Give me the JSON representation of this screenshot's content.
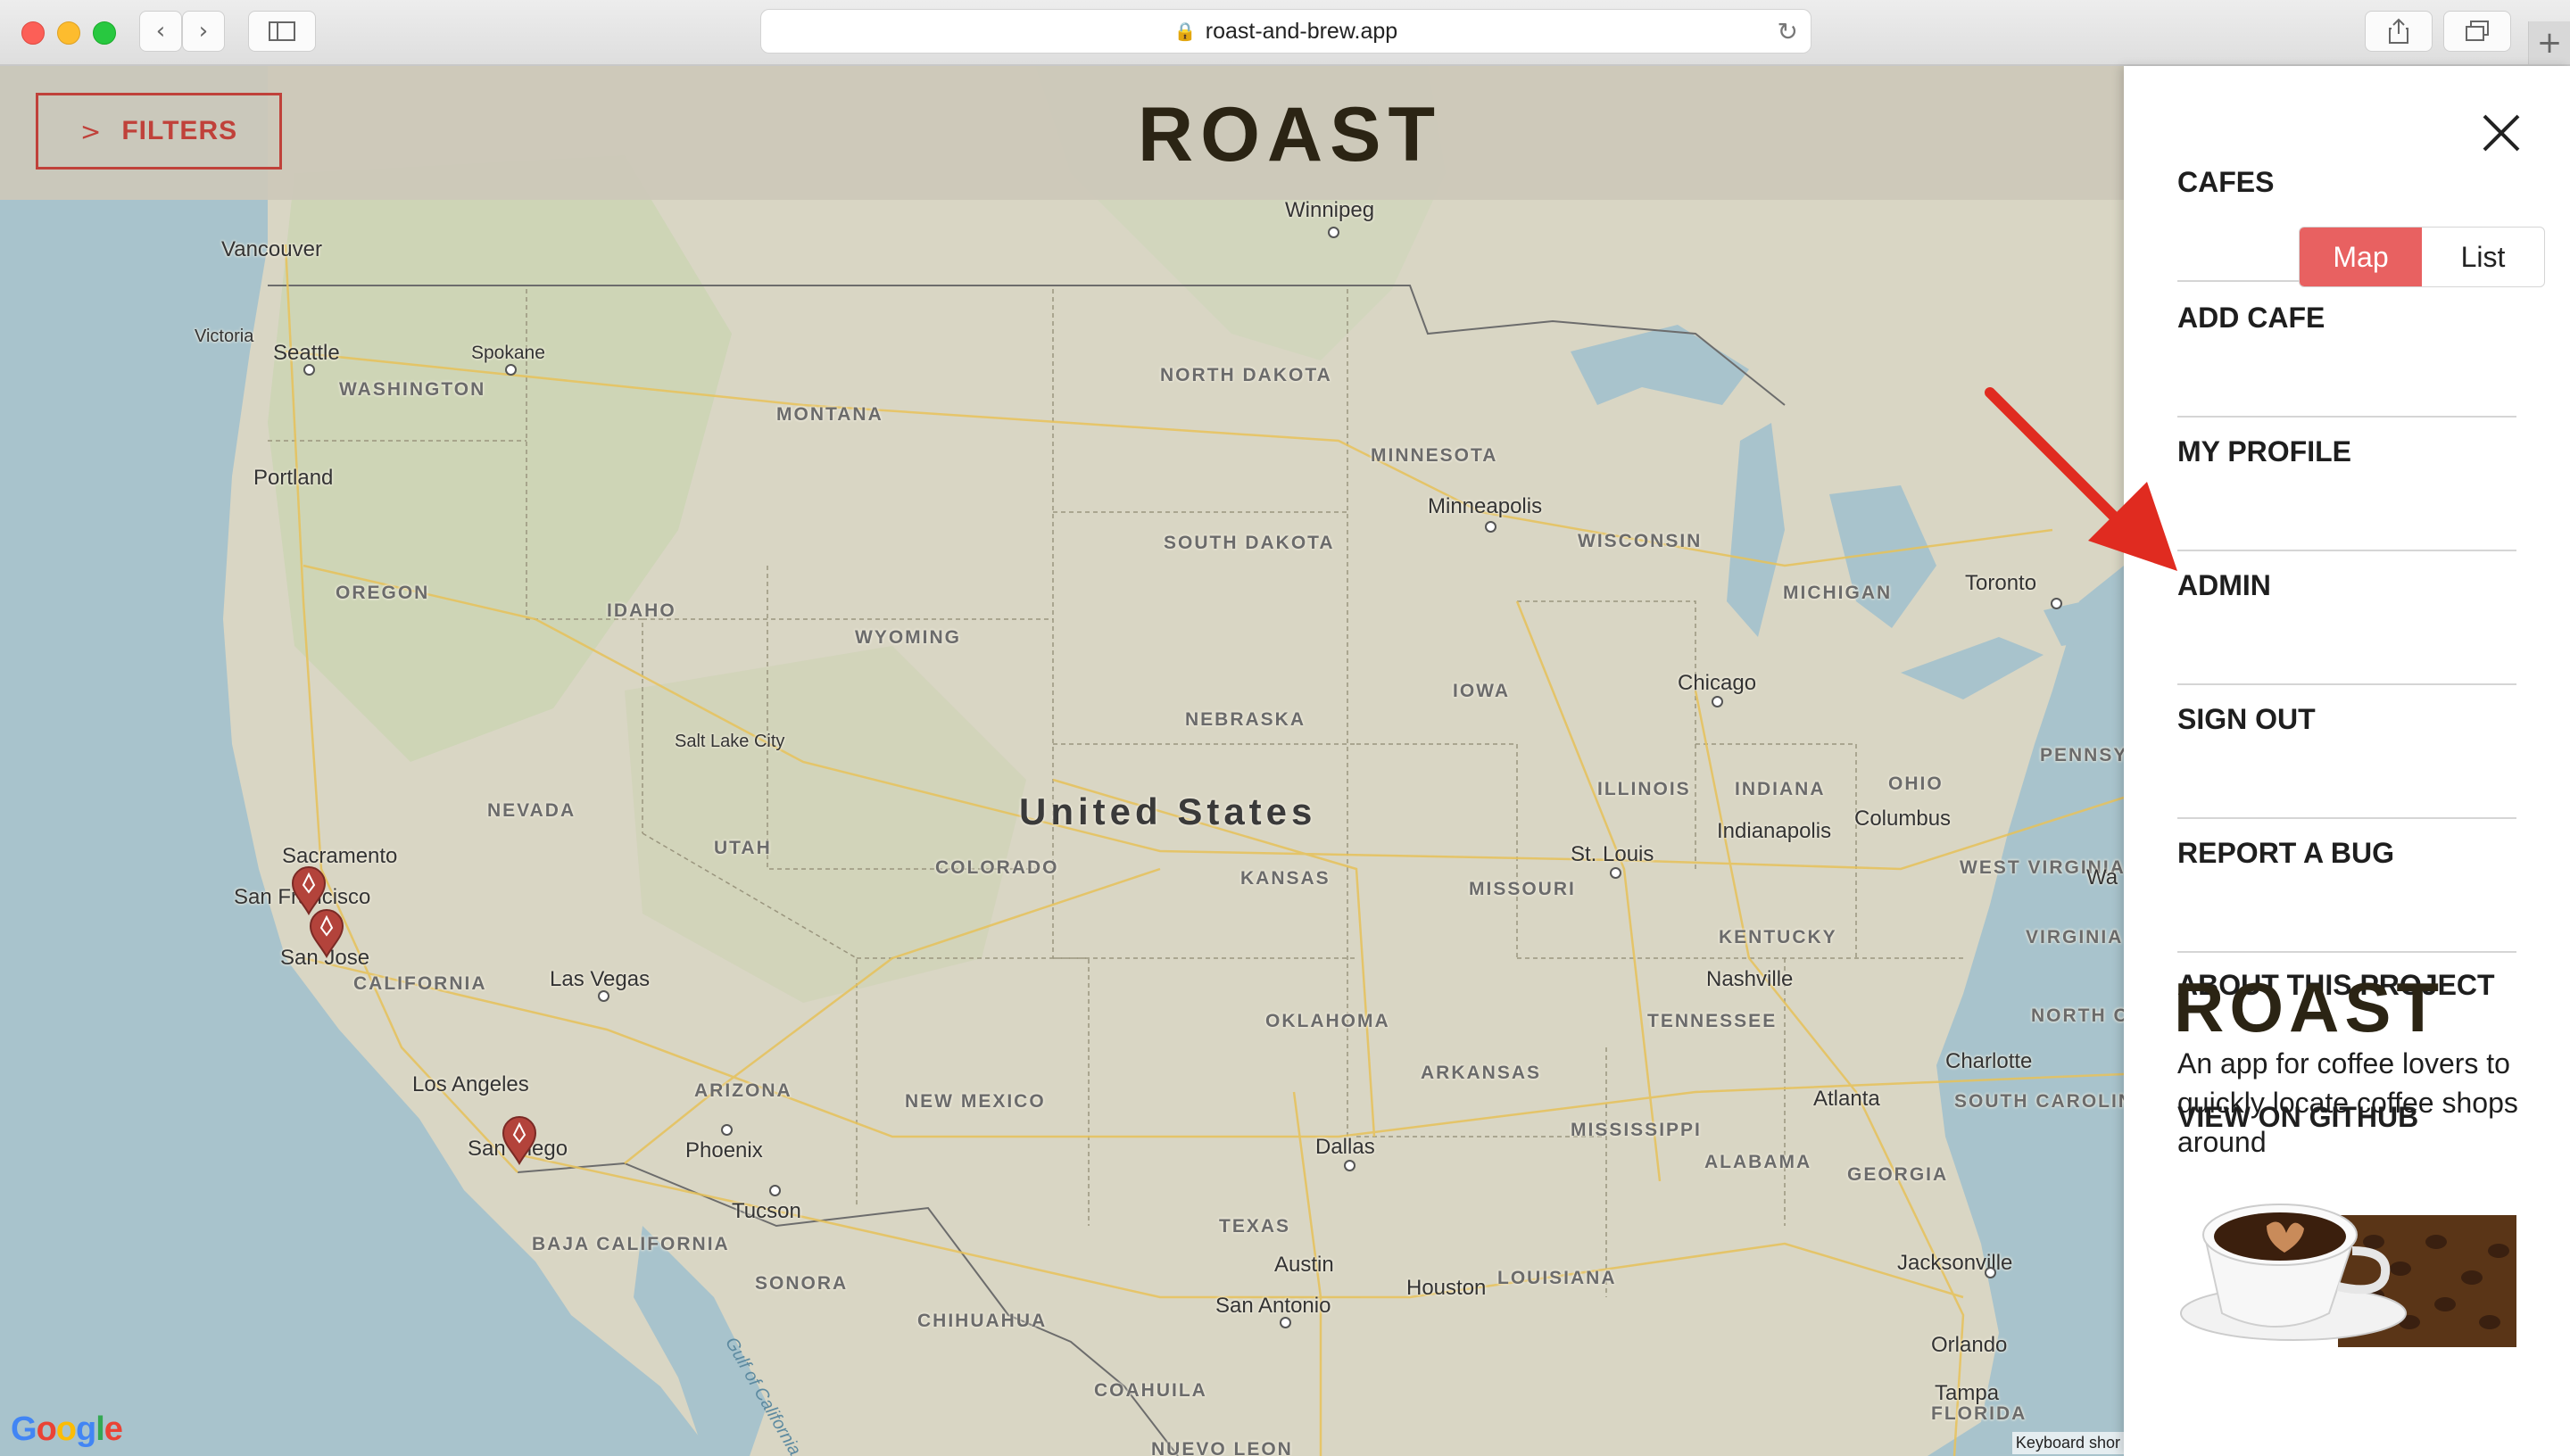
{
  "browser": {
    "url": "roast-and-brew.app"
  },
  "header": {
    "filters_label": "FILTERS",
    "logo": "ROAST"
  },
  "map": {
    "country_label": "United States",
    "cities": [
      {
        "name": "Winnipeg"
      },
      {
        "name": "Vancouver"
      },
      {
        "name": "Victoria"
      },
      {
        "name": "Seattle"
      },
      {
        "name": "Spokane"
      },
      {
        "name": "Portland"
      },
      {
        "name": "Minneapolis"
      },
      {
        "name": "Toronto"
      },
      {
        "name": "Chicago"
      },
      {
        "name": "Salt Lake City"
      },
      {
        "name": "Sacramento"
      },
      {
        "name": "San Francisco"
      },
      {
        "name": "San Jose"
      },
      {
        "name": "Las Vegas"
      },
      {
        "name": "Los Angeles"
      },
      {
        "name": "San Diego"
      },
      {
        "name": "Phoenix"
      },
      {
        "name": "Tucson"
      },
      {
        "name": "Dallas"
      },
      {
        "name": "Austin"
      },
      {
        "name": "San Antonio"
      },
      {
        "name": "Houston"
      },
      {
        "name": "St. Louis"
      },
      {
        "name": "Indianapolis"
      },
      {
        "name": "Columbus"
      },
      {
        "name": "Nashville"
      },
      {
        "name": "Atlanta"
      },
      {
        "name": "Charlotte"
      },
      {
        "name": "Jacksonville"
      },
      {
        "name": "Orlando"
      },
      {
        "name": "Tampa"
      }
    ],
    "states": [
      "WASHINGTON",
      "MONTANA",
      "NORTH DAKOTA",
      "MINNESOTA",
      "OREGON",
      "IDAHO",
      "SOUTH DAKOTA",
      "WISCONSIN",
      "MICHIGAN",
      "WYOMING",
      "IOWA",
      "NEBRASKA",
      "NEVADA",
      "UTAH",
      "COLORADO",
      "KANSAS",
      "MISSOURI",
      "ILLINOIS",
      "INDIANA",
      "OHIO",
      "WEST VIRGINIA",
      "CALIFORNIA",
      "OKLAHOMA",
      "KENTUCKY",
      "VIRGINIA",
      "TENNESSEE",
      "NORTH CAROLINA",
      "ARIZONA",
      "NEW MEXICO",
      "ARKANSAS",
      "SOUTH CAROLINA",
      "MISSISSIPPI",
      "ALABAMA",
      "GEORGIA",
      "TEXAS",
      "LOUISIANA",
      "FLORIDA",
      "BAJA CALIFORNIA",
      "SONORA",
      "CHIHUAHUA",
      "COAHUILA",
      "NUEVO LEON",
      "PENNSY",
      "Wa"
    ],
    "water_labels": [
      "Gulf of California"
    ],
    "google": "Google",
    "keyboard": "Keyboard shor"
  },
  "sidebar": {
    "cafes": "CAFES",
    "toggle_map": "Map",
    "toggle_list": "List",
    "add_cafe": "ADD CAFE",
    "my_profile": "MY PROFILE",
    "admin": "ADMIN",
    "sign_out": "SIGN OUT",
    "report_bug": "REPORT A BUG",
    "about_title": "ABOUT THIS PROJECT",
    "about_logo": "ROAST",
    "about_desc": "An app for coffee lovers to quickly locate coffee shops around",
    "view_github": "VIEW ON GITHUB"
  },
  "colors": {
    "accent": "#c0413a",
    "toggle_active": "#e86161",
    "annotation_arrow": "#e02b20"
  }
}
